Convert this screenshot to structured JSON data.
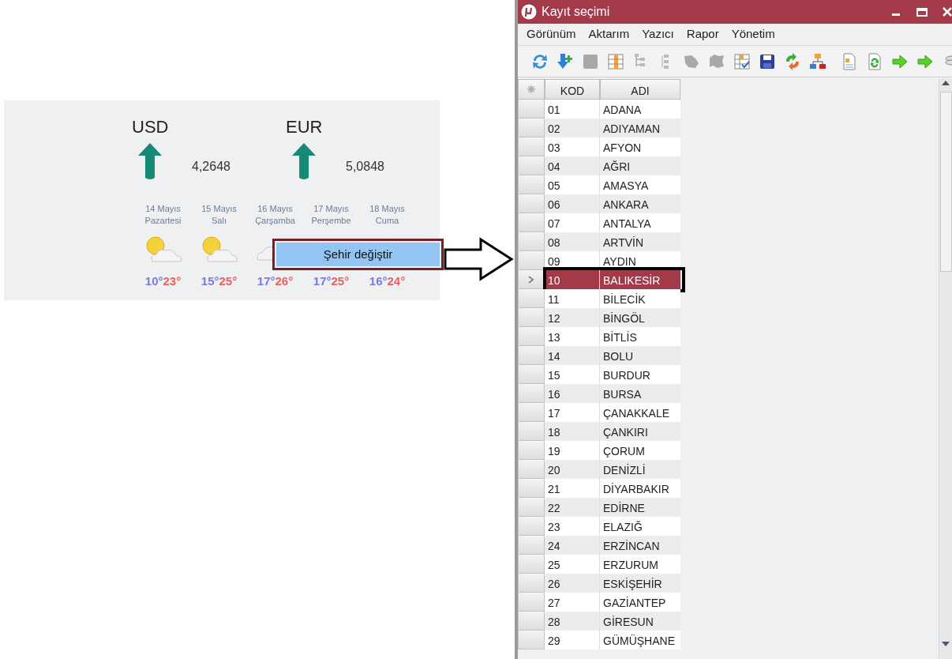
{
  "currencies": [
    {
      "code": "USD",
      "kind": "rising",
      "rate": "4,2648"
    },
    {
      "code": "EUR",
      "kind": "rising",
      "rate": "5,0848"
    }
  ],
  "forecast": [
    {
      "date": "14 Mayıs",
      "weekday": "Pazartesi",
      "kind": "partly-cloudy",
      "low": "10°",
      "high": "23°"
    },
    {
      "date": "15 Mayıs",
      "weekday": "Salı",
      "kind": "partly-cloudy",
      "low": "15°",
      "high": "25°"
    },
    {
      "date": "16 Mayıs",
      "weekday": "Çarşamba",
      "kind": "cloudy",
      "low": "17°",
      "high": "26°"
    },
    {
      "date": "17 Mayıs",
      "weekday": "Perşembe",
      "low": "17°",
      "high": "25°"
    },
    {
      "date": "18 Mayıs",
      "weekday": "Cuma",
      "low": "16°",
      "high": "24°"
    }
  ],
  "context_menu": {
    "items": [
      "Şehir değiştir"
    ]
  },
  "window": {
    "title": "Kayıt seçimi",
    "menu": [
      "Görünüm",
      "Aktarım",
      "Yazıcı",
      "Rapor",
      "Yönetim"
    ],
    "grid": {
      "columns": [
        "KOD",
        "ADI"
      ],
      "rows": [
        {
          "code": "01",
          "name": "ADANA",
          "selected": false
        },
        {
          "code": "02",
          "name": "ADIYAMAN",
          "selected": false
        },
        {
          "code": "03",
          "name": "AFYON",
          "selected": false
        },
        {
          "code": "04",
          "name": "AĞRI",
          "selected": false
        },
        {
          "code": "05",
          "name": "AMASYA",
          "selected": false
        },
        {
          "code": "06",
          "name": "ANKARA",
          "selected": false
        },
        {
          "code": "07",
          "name": "ANTALYA",
          "selected": false
        },
        {
          "code": "08",
          "name": "ARTVİN",
          "selected": false
        },
        {
          "code": "09",
          "name": "AYDIN",
          "selected": false
        },
        {
          "code": "10",
          "name": "BALIKESİR",
          "selected": true
        },
        {
          "code": "11",
          "name": "BİLECİK",
          "selected": false
        },
        {
          "code": "12",
          "name": "BİNGÖL",
          "selected": false
        },
        {
          "code": "13",
          "name": "BİTLİS",
          "selected": false
        },
        {
          "code": "14",
          "name": "BOLU",
          "selected": false
        },
        {
          "code": "15",
          "name": "BURDUR",
          "selected": false
        },
        {
          "code": "16",
          "name": "BURSA",
          "selected": false
        },
        {
          "code": "17",
          "name": "ÇANAKKALE",
          "selected": false
        },
        {
          "code": "18",
          "name": "ÇANKIRI",
          "selected": false
        },
        {
          "code": "19",
          "name": "ÇORUM",
          "selected": false
        },
        {
          "code": "20",
          "name": "DENİZLİ",
          "selected": false
        },
        {
          "code": "21",
          "name": "DİYARBAKIR",
          "selected": false
        },
        {
          "code": "22",
          "name": "EDİRNE",
          "selected": false
        },
        {
          "code": "23",
          "name": "ELAZIĞ",
          "selected": false
        },
        {
          "code": "24",
          "name": "ERZİNCAN",
          "selected": false
        },
        {
          "code": "25",
          "name": "ERZURUM",
          "selected": false
        },
        {
          "code": "26",
          "name": "ESKİŞEHİR",
          "selected": false
        },
        {
          "code": "27",
          "name": "GAZİANTEP",
          "selected": false
        },
        {
          "code": "28",
          "name": "GİRESUN",
          "selected": false
        },
        {
          "code": "29",
          "name": "GÜMÜŞHANE",
          "selected": false
        }
      ]
    }
  }
}
